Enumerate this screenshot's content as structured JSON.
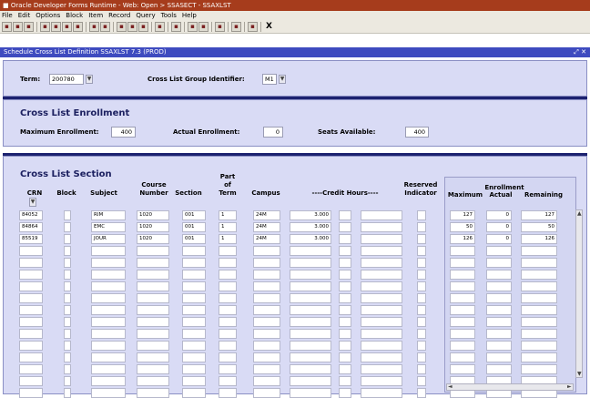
{
  "window": {
    "title": "Oracle Developer Forms Runtime - Web: Open > SSASECT - SSAXLST"
  },
  "menu": [
    "File",
    "Edit",
    "Options",
    "Block",
    "Item",
    "Record",
    "Query",
    "Tools",
    "Help"
  ],
  "toolbar": {
    "exit_label": "X"
  },
  "form": {
    "title": "Schedule Cross List Definition  SSAXLST  7.3  (PROD)"
  },
  "key_block": {
    "term_label": "Term:",
    "term_value": "200780",
    "group_label": "Cross List Group Identifier:",
    "group_value": "M1",
    "lov_symbol": "▼"
  },
  "enrollment_block": {
    "heading": "Cross List Enrollment",
    "max_label": "Maximum Enrollment:",
    "max_value": "400",
    "actual_label": "Actual Enrollment:",
    "actual_value": "0",
    "seats_label": "Seats Available:",
    "seats_value": "400"
  },
  "section_block": {
    "heading": "Cross List Section",
    "columns": {
      "crn": "CRN",
      "block": "Block",
      "subject": "Subject",
      "course_number_1": "Course",
      "course_number_2": "Number",
      "section": "Section",
      "part_1": "Part",
      "part_2": "of",
      "part_3": "Term",
      "campus": "Campus",
      "credit_hours": "----Credit Hours----",
      "reserved_1": "Reserved",
      "reserved_2": "Indicator",
      "enrollment": "Enrollment",
      "maximum": "Maximum",
      "actual": "Actual",
      "remaining": "Remaining"
    },
    "rows": [
      {
        "crn": "84052",
        "block": "",
        "subject": "RIM",
        "course": "1020",
        "section": "001",
        "part": "1",
        "campus": "24M",
        "credit": "3.000",
        "maximum": "127",
        "actual": "0",
        "remaining": "127"
      },
      {
        "crn": "84864",
        "block": "",
        "subject": "EMC",
        "course": "1020",
        "section": "001",
        "part": "1",
        "campus": "24M",
        "credit": "3.000",
        "maximum": "50",
        "actual": "0",
        "remaining": "50"
      },
      {
        "crn": "85519",
        "block": "",
        "subject": "JOUR",
        "course": "1020",
        "section": "001",
        "part": "1",
        "campus": "24M",
        "credit": "3.000",
        "maximum": "126",
        "actual": "0",
        "remaining": "126"
      }
    ],
    "empty_rows": 13
  }
}
